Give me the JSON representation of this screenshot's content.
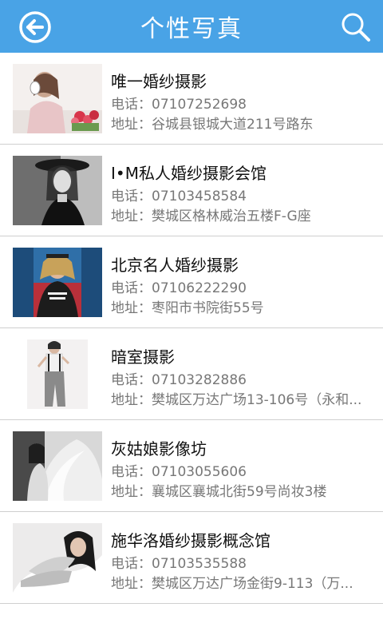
{
  "header": {
    "title": "个性写真",
    "back_icon": "back-arrow-circle-icon",
    "search_icon": "search-icon",
    "bar_color": "#49a3e6"
  },
  "studios": [
    {
      "name": "唯一婚纱摄影",
      "phone": "电话：07107252698",
      "address": "地址：谷城县银城大道211号路东"
    },
    {
      "name": "I•M私人婚纱摄影会馆",
      "phone": "电话：07103458584",
      "address": "地址：樊城区格林威治五楼F-G座"
    },
    {
      "name": "北京名人婚纱摄影",
      "phone": "电话：07106222290",
      "address": "地址：枣阳市书院街55号"
    },
    {
      "name": "暗室摄影",
      "phone": "电话：07103282886",
      "address": "地址：樊城区万达广场13-106号（永和..."
    },
    {
      "name": "灰姑娘影像坊",
      "phone": "电话：07103055606",
      "address": "地址：襄城区襄城北街59号尚妆3楼"
    },
    {
      "name": "施华洛婚纱摄影概念馆",
      "phone": "电话：07103535588",
      "address": "地址：樊城区万达广场金街9-113（万..."
    }
  ]
}
